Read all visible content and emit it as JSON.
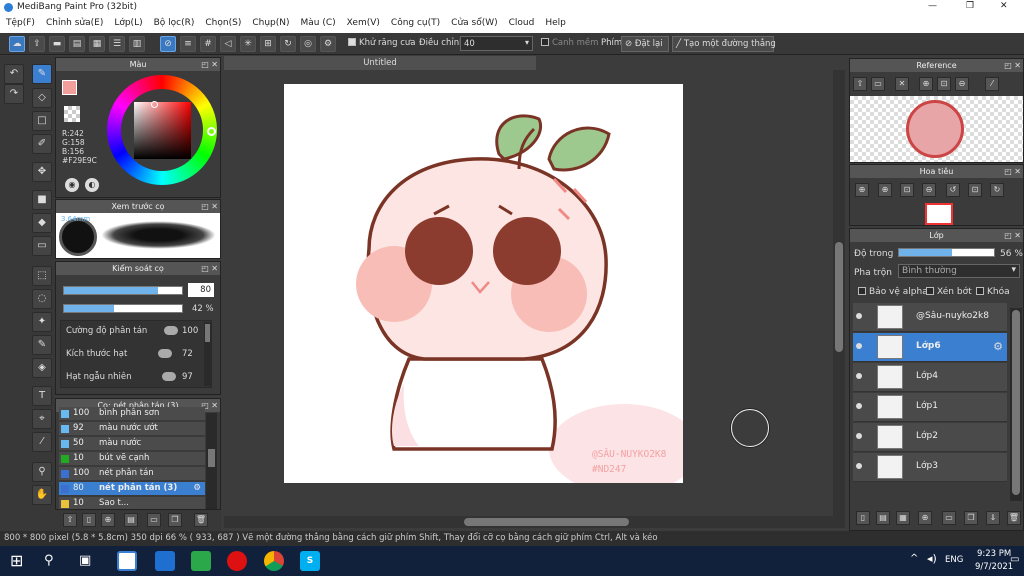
{
  "window": {
    "title": "MediBang Paint Pro (32bit)",
    "min": "—",
    "max": "❐",
    "close": "✕"
  },
  "menu": [
    "Tệp(F)",
    "Chỉnh sửa(E)",
    "Lớp(L)",
    "Bộ lọc(R)",
    "Chọn(S)",
    "Chụp(N)",
    "Màu (C)",
    "Xem(V)",
    "Công cụ(T)",
    "Cửa sổ(W)",
    "Cloud",
    "Help"
  ],
  "toolbar": {
    "antialias_label": "Khử răng cưa",
    "adjust_label": "Điều chỉnh",
    "adjust_value": "40",
    "smooth_label": "Canh mềm",
    "key_label": "Phím",
    "reset_label": "Đặt lại",
    "straight_label": "Tạo một đường thẳng"
  },
  "color_panel": {
    "title": "Màu",
    "rgb": {
      "r": "R:242",
      "g": "G:158",
      "b": "B:156"
    },
    "hex": "#F29E9C",
    "fg_color": "#f29e9c"
  },
  "preview_panel": {
    "title": "Xem trước cọ",
    "size": "3.64mm"
  },
  "brush_control": {
    "title": "Kiểm soát cọ",
    "size_value": "80",
    "size_level": 0.8,
    "opacity_value": "42",
    "opacity_unit": "%",
    "opacity_level": 0.42,
    "params": [
      {
        "label": "Cường độ phân tán",
        "value": "100",
        "level": 1.0
      },
      {
        "label": "Kích thước hạt",
        "value": "72",
        "level": 0.72
      },
      {
        "label": "Hạt ngẫu nhiên",
        "value": "97",
        "level": 0.97
      }
    ]
  },
  "brush_list": {
    "title": "Cọ: nét phân tán (3)",
    "items": [
      {
        "num": "100",
        "name": "bình phân sơn",
        "color": "#6ab8f0"
      },
      {
        "num": "92",
        "name": "màu nước ướt",
        "color": "#6ab8f0"
      },
      {
        "num": "50",
        "name": "màu nước",
        "color": "#6ab8f0"
      },
      {
        "num": "10",
        "name": "bút vẽ cạnh",
        "color": "#22aa22"
      },
      {
        "num": "100",
        "name": "nét phân tán",
        "color": "#3b6fd0"
      },
      {
        "num": "80",
        "name": "nét phân tán (3)",
        "color": "#3b6fd0"
      },
      {
        "num": "10",
        "name": "Sao t...",
        "color": "#e8c23a"
      }
    ]
  },
  "canvas": {
    "tab_title": "Untitled",
    "watermark_line1": "@SÂU-NUYKO2K8",
    "watermark_line2": "#ND247"
  },
  "reference_panel": {
    "title": "Reference"
  },
  "navigator_panel": {
    "title": "Hoa tiêu"
  },
  "layer_panel": {
    "title": "Lớp",
    "opacity_label": "Độ trong",
    "opacity_value": "56",
    "opacity_unit": "%",
    "opacity_level": 0.56,
    "blend_label": "Pha trộn",
    "blend_value": "Bình thường",
    "alpha_label": "Bảo vệ alpha",
    "clip_label": "Xén bớt",
    "lock_label": "Khóa",
    "layers": [
      {
        "name": "@Sâu-nuyko2k8",
        "selected": false
      },
      {
        "name": "Lớp6",
        "selected": true
      },
      {
        "name": "Lớp4",
        "selected": false
      },
      {
        "name": "Lớp1",
        "selected": false
      },
      {
        "name": "Lớp2",
        "selected": false
      },
      {
        "name": "Lớp3",
        "selected": false
      }
    ]
  },
  "status": "800 * 800 pixel  (5.8 * 5.8cm)  350 dpi  66 %  ( 933, 687 )  Vẽ một đường thẳng bằng cách giữ phím Shift, Thay đổi cỡ cọ bằng cách giữ phím Ctrl, Alt và kéo",
  "taskbar": {
    "lang": "ENG",
    "time": "9:23 PM",
    "date": "9/7/2021"
  }
}
